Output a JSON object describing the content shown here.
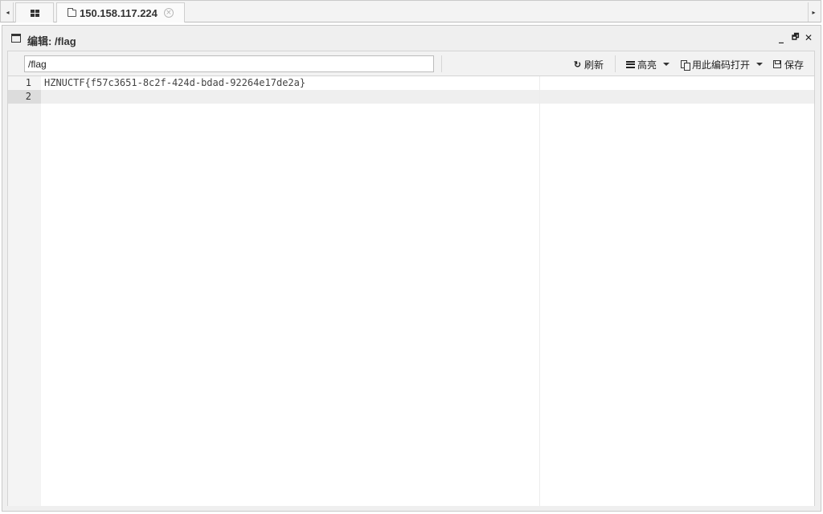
{
  "tabbar": {
    "scroll_left_glyph": "◂",
    "scroll_right_glyph": "▸",
    "tabs": [
      {
        "icon": "grid-icon",
        "label": ""
      },
      {
        "icon": "folder-icon",
        "label": "150.158.117.224",
        "close_glyph": "×"
      }
    ]
  },
  "window": {
    "icon": "window-icon",
    "title": "编辑: /flag",
    "controls": {
      "minimize": "_",
      "restore": "🗗",
      "close": "✕"
    }
  },
  "toolbar": {
    "path_value": "/flag",
    "refresh_label": "刷新",
    "highlight_label": "高亮",
    "encoding_label": "用此编码打开",
    "save_label": "保存",
    "refresh_glyph": "↻"
  },
  "editor": {
    "lines": [
      {
        "number": "1",
        "text": "HZNUCTF{f57c3651-8c2f-424d-bdad-92264e17de2a}"
      },
      {
        "number": "2",
        "text": ""
      }
    ],
    "active_line": 2
  }
}
